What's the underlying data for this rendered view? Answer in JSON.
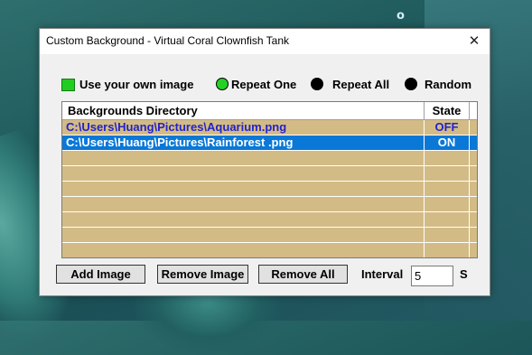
{
  "desktop": {
    "bubble_glyph": "o"
  },
  "window": {
    "title": "Custom Background - Virtual Coral Clownfish Tank",
    "close_glyph": "✕"
  },
  "options": {
    "use_own": "Use your own image",
    "repeat_one": "Repeat One",
    "repeat_all": "Repeat All",
    "random": "Random",
    "selected": "repeat_one"
  },
  "list": {
    "headers": [
      "Backgrounds Directory",
      "State"
    ],
    "rows": [
      {
        "path": "C:\\Users\\Huang\\Pictures\\Aquarium.png",
        "state": "OFF"
      },
      {
        "path": "C:\\Users\\Huang\\Pictures\\Rainforest .png",
        "state": "ON"
      }
    ]
  },
  "buttons": {
    "add": "Add Image",
    "remove": "Remove Image",
    "remove_all": "Remove All"
  },
  "interval": {
    "label": "Interval",
    "value": "5",
    "unit": "S"
  },
  "colors": {
    "list_bg": "#d3bb86",
    "selection": "#0a78d7",
    "active_text": "#2222cc",
    "toggle_green": "#22cc22"
  }
}
